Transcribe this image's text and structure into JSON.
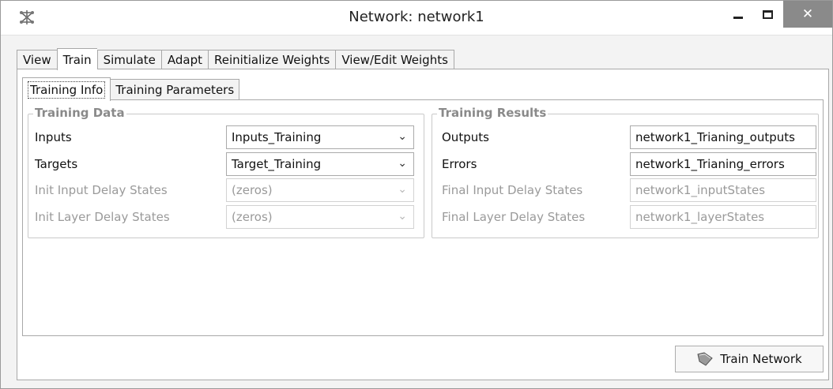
{
  "window": {
    "title": "Network: network1",
    "close_glyph": "✕",
    "app_icon": "network-icon"
  },
  "tabs": [
    {
      "label": "View"
    },
    {
      "label": "Train",
      "active": true
    },
    {
      "label": "Simulate"
    },
    {
      "label": "Adapt"
    },
    {
      "label": "Reinitialize Weights"
    },
    {
      "label": "View/Edit Weights"
    }
  ],
  "subtabs": [
    {
      "label": "Training Info",
      "active": true
    },
    {
      "label": "Training Parameters"
    }
  ],
  "training_data": {
    "legend": "Training Data",
    "rows": [
      {
        "label": "Inputs",
        "value": "Inputs_Training",
        "enabled": true
      },
      {
        "label": "Targets",
        "value": "Target_Training",
        "enabled": true
      },
      {
        "label": "Init Input Delay States",
        "value": "(zeros)",
        "enabled": false
      },
      {
        "label": "Init Layer Delay States",
        "value": "(zeros)",
        "enabled": false
      }
    ]
  },
  "training_results": {
    "legend": "Training Results",
    "rows": [
      {
        "label": "Outputs",
        "value": "network1_Trianing_outputs",
        "enabled": true
      },
      {
        "label": "Errors",
        "value": "network1_Trianing_errors",
        "enabled": true
      },
      {
        "label": "Final Input Delay States",
        "value": "network1_inputStates",
        "enabled": false
      },
      {
        "label": "Final Layer Delay States",
        "value": "network1_layerStates",
        "enabled": false
      }
    ]
  },
  "actions": {
    "train_label": "Train Network",
    "train_icon": "train-network-icon"
  }
}
